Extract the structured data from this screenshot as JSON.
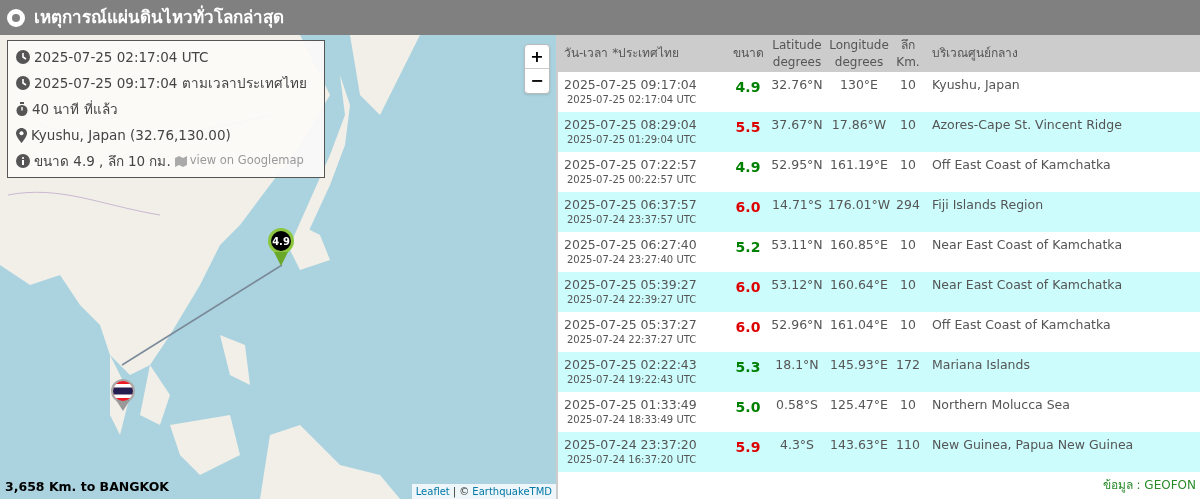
{
  "header": {
    "title": "เหตุการณ์แผ่นดินไหวทั่วโลกล่าสุด"
  },
  "map": {
    "info": [
      {
        "kind": "clock",
        "text": "2025-07-25 02:17:04 UTC"
      },
      {
        "kind": "clock",
        "text": "2025-07-25 09:17:04 ตามเวลาประเทศไทย"
      },
      {
        "kind": "stopwatch",
        "text": "40 นาที ที่แล้ว"
      },
      {
        "kind": "pin",
        "text": "Kyushu, Japan (32.76,130.00)"
      },
      {
        "kind": "info",
        "text": "ขนาด 4.9 , ลึก 10 กม.",
        "link": "view on Googlemap"
      }
    ],
    "zoom_in": "+",
    "zoom_out": "−",
    "marker_label": "4.9",
    "distance": "3,658 Km. to BANGKOK",
    "attribution": {
      "leaflet": "Leaflet",
      "separator": "| ©",
      "source": "EarthquakeTMD"
    }
  },
  "table": {
    "columns": [
      "วัน-เวลา *ประเทศไทย",
      "ขนาด",
      "Latitude degrees",
      "Longitude degrees",
      "ลึก Km.",
      "บริเวณศูนย์กลาง"
    ],
    "rows": [
      {
        "local": "2025-07-25 09:17:04",
        "utc": "2025-07-25 02:17:04 UTC",
        "mag": "4.9",
        "color": "#008000",
        "lat": "32.76°N",
        "lon": "130°E",
        "depth": "10",
        "region": "Kyushu, Japan"
      },
      {
        "local": "2025-07-25 08:29:04",
        "utc": "2025-07-25 01:29:04 UTC",
        "mag": "5.5",
        "color": "#dd0000",
        "lat": "37.67°N",
        "lon": "17.86°W",
        "depth": "10",
        "region": "Azores-Cape St. Vincent Ridge"
      },
      {
        "local": "2025-07-25 07:22:57",
        "utc": "2025-07-25 00:22:57 UTC",
        "mag": "4.9",
        "color": "#008000",
        "lat": "52.95°N",
        "lon": "161.19°E",
        "depth": "10",
        "region": "Off East Coast of Kamchatka"
      },
      {
        "local": "2025-07-25 06:37:57",
        "utc": "2025-07-24 23:37:57 UTC",
        "mag": "6.0",
        "color": "#dd0000",
        "lat": "14.71°S",
        "lon": "176.01°W",
        "depth": "294",
        "region": "Fiji Islands Region"
      },
      {
        "local": "2025-07-25 06:27:40",
        "utc": "2025-07-24 23:27:40 UTC",
        "mag": "5.2",
        "color": "#008000",
        "lat": "53.11°N",
        "lon": "160.85°E",
        "depth": "10",
        "region": "Near East Coast of Kamchatka"
      },
      {
        "local": "2025-07-25 05:39:27",
        "utc": "2025-07-24 22:39:27 UTC",
        "mag": "6.0",
        "color": "#dd0000",
        "lat": "53.12°N",
        "lon": "160.64°E",
        "depth": "10",
        "region": "Near East Coast of Kamchatka"
      },
      {
        "local": "2025-07-25 05:37:27",
        "utc": "2025-07-24 22:37:27 UTC",
        "mag": "6.0",
        "color": "#dd0000",
        "lat": "52.96°N",
        "lon": "161.04°E",
        "depth": "10",
        "region": "Off East Coast of Kamchatka"
      },
      {
        "local": "2025-07-25 02:22:43",
        "utc": "2025-07-24 19:22:43 UTC",
        "mag": "5.3",
        "color": "#008000",
        "lat": "18.1°N",
        "lon": "145.93°E",
        "depth": "172",
        "region": "Mariana Islands"
      },
      {
        "local": "2025-07-25 01:33:49",
        "utc": "2025-07-24 18:33:49 UTC",
        "mag": "5.0",
        "color": "#008000",
        "lat": "0.58°S",
        "lon": "125.47°E",
        "depth": "10",
        "region": "Northern Molucca Sea"
      },
      {
        "local": "2025-07-24 23:37:20",
        "utc": "2025-07-24 16:37:20 UTC",
        "mag": "5.9",
        "color": "#dd0000",
        "lat": "4.3°S",
        "lon": "143.63°E",
        "depth": "110",
        "region": "New Guinea, Papua New Guinea"
      }
    ],
    "source": "ข้อมูล : GEOFON"
  }
}
